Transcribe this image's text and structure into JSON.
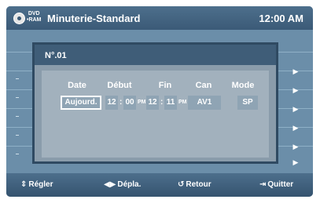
{
  "header": {
    "disc_label_top": "DVD",
    "disc_label_bottom": "•RAM",
    "title": "Minuterie-Standard",
    "clock": "12:00 AM"
  },
  "dialog": {
    "title": "N°.01",
    "columns": {
      "date": "Date",
      "start": "Début",
      "end": "Fin",
      "channel": "Can",
      "mode": "Mode"
    },
    "values": {
      "date": "Aujourd.",
      "start_hour": "12",
      "start_min": "00",
      "start_ampm": "PM",
      "end_hour": "12",
      "end_min": "11",
      "end_ampm": "PM",
      "channel": "AV1",
      "mode": "SP"
    }
  },
  "footer": {
    "adjust_icon": "up-down-icon",
    "adjust": "Régler",
    "move_icon": "left-right-icon",
    "move": "Dépla.",
    "return_icon": "return-icon",
    "return": "Retour",
    "exit_icon": "exit-icon",
    "exit": "Quitter"
  },
  "colors": {
    "background": "#5b7e9c",
    "header": "#3b5a77",
    "dialog": "#8a9cab"
  }
}
